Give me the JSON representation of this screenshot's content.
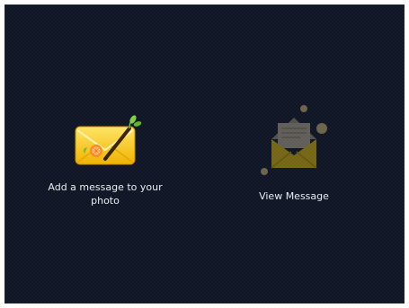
{
  "menu": {
    "add_message": {
      "label": "Add a message to your photo",
      "icon": "envelope-pen-icon"
    },
    "view_message": {
      "label": "View Message",
      "icon": "open-envelope-icon",
      "state": "disabled"
    }
  },
  "colors": {
    "background": "#0d1424",
    "envelope": "#f2c21c",
    "label": "#e8ecf2"
  }
}
